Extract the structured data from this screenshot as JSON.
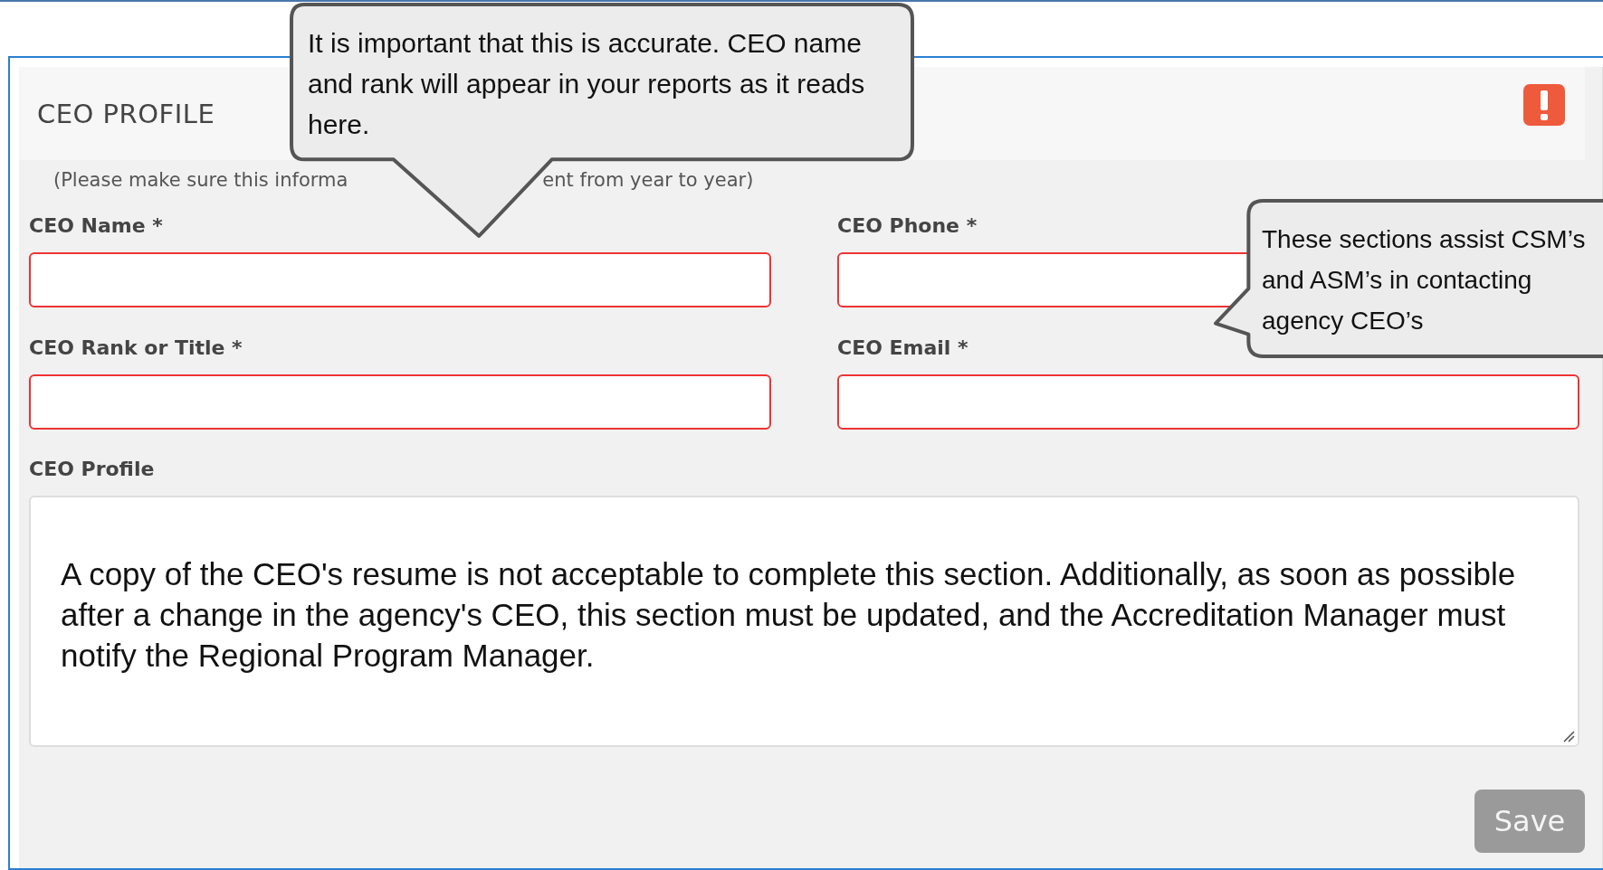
{
  "panel": {
    "title": "CEO PROFILE",
    "alert": true,
    "subtitle_parts": [
      "(Please make sure this informa",
      "ent from year to year)"
    ]
  },
  "fields": [
    {
      "label": "CEO Name *",
      "kind": "input",
      "invalid": true
    },
    {
      "label": "CEO Phone *",
      "kind": "input",
      "invalid": true
    },
    {
      "label": "CEO Rank or Title *",
      "kind": "input",
      "invalid": true
    },
    {
      "label": "CEO Email *",
      "kind": "input",
      "invalid": true
    },
    {
      "label": "CEO Profile",
      "kind": "textarea",
      "invalid": false,
      "value": "A copy of the CEO's resume is not acceptable to complete this section. Additionally, as soon as possible after a change in the agency's CEO, this section must be updated, and the Accreditation Manager must notify the Regional Program Manager."
    }
  ],
  "save_button": {
    "label": "Save",
    "disabled": true
  },
  "callouts": [
    {
      "text": "It is important that this is accurate. CEO name and rank will appear in your reports as it reads here.",
      "kind": "below"
    },
    {
      "text": "These sections assist CSM’s and ASM’s in contacting agency CEO’s",
      "kind": "beside"
    }
  ]
}
